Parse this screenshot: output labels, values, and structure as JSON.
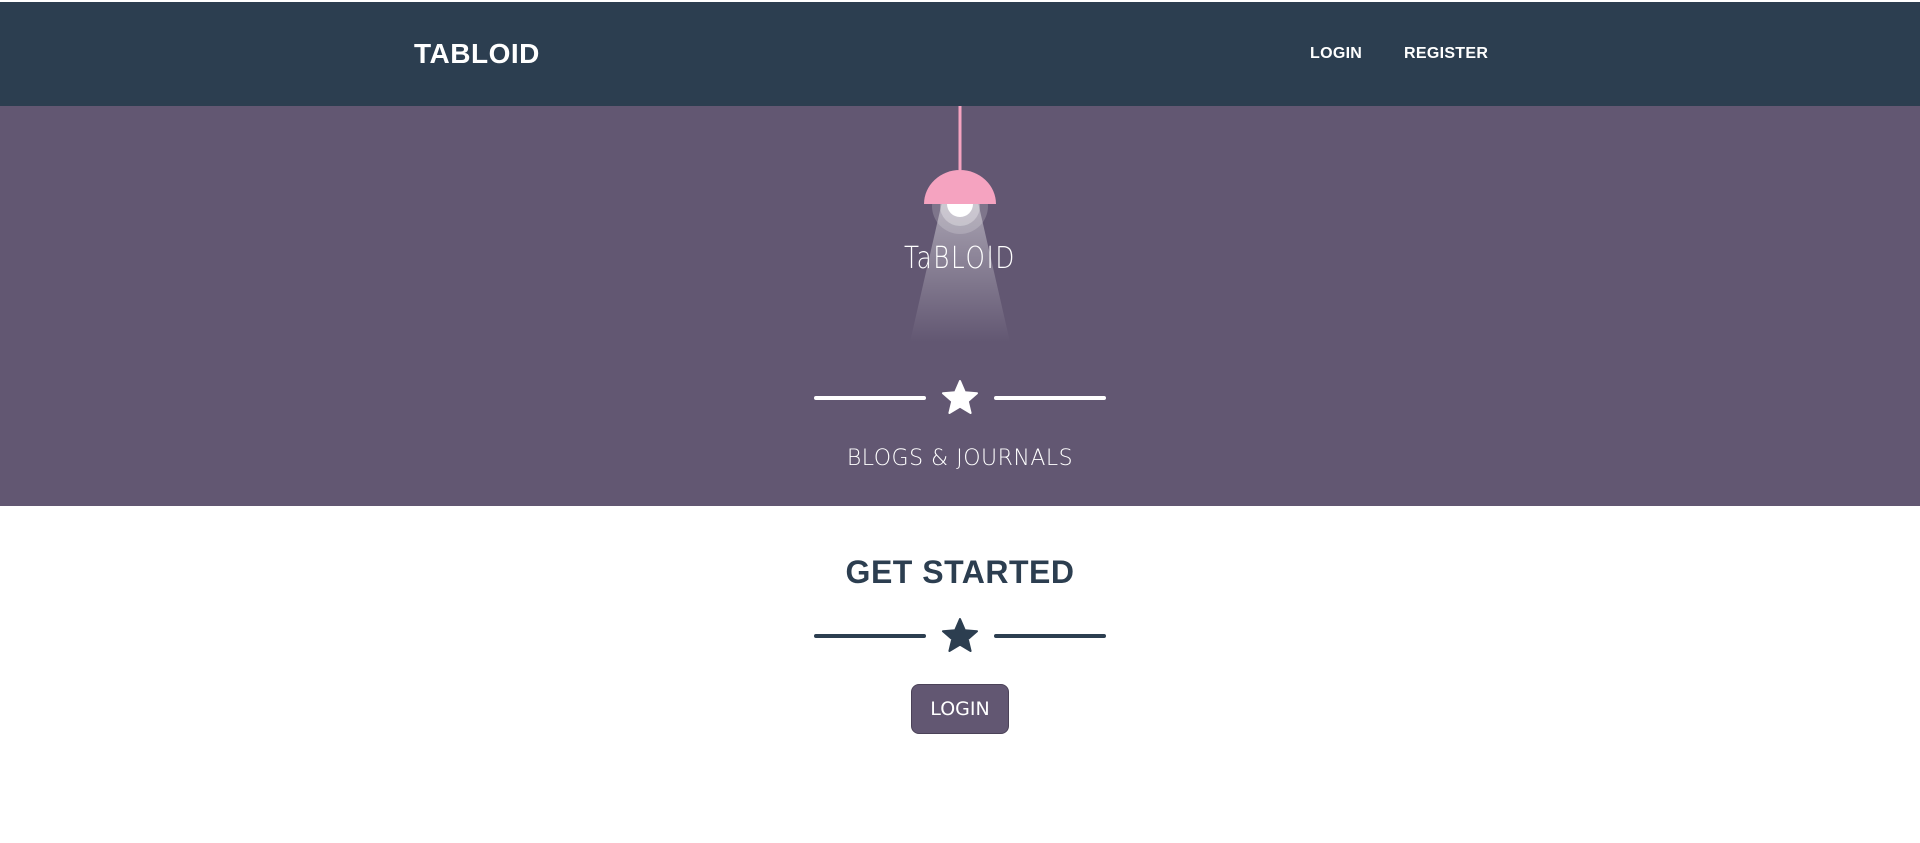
{
  "navbar": {
    "brand": "TABLOID",
    "links": [
      {
        "label": "LOGIN"
      },
      {
        "label": "REGISTER"
      }
    ]
  },
  "masthead": {
    "logo_text": "TaBLOID",
    "subheading": "BLOGS & JOURNALS",
    "divider_icon": "star-icon"
  },
  "content": {
    "heading": "GET STARTED",
    "divider_icon": "star-icon",
    "login_button": "LOGIN"
  },
  "colors": {
    "navbar": "#2c3e50",
    "masthead": "#625772",
    "lamp_shade": "#f5a3c0",
    "button": "#625772",
    "heading": "#2c3e50"
  }
}
